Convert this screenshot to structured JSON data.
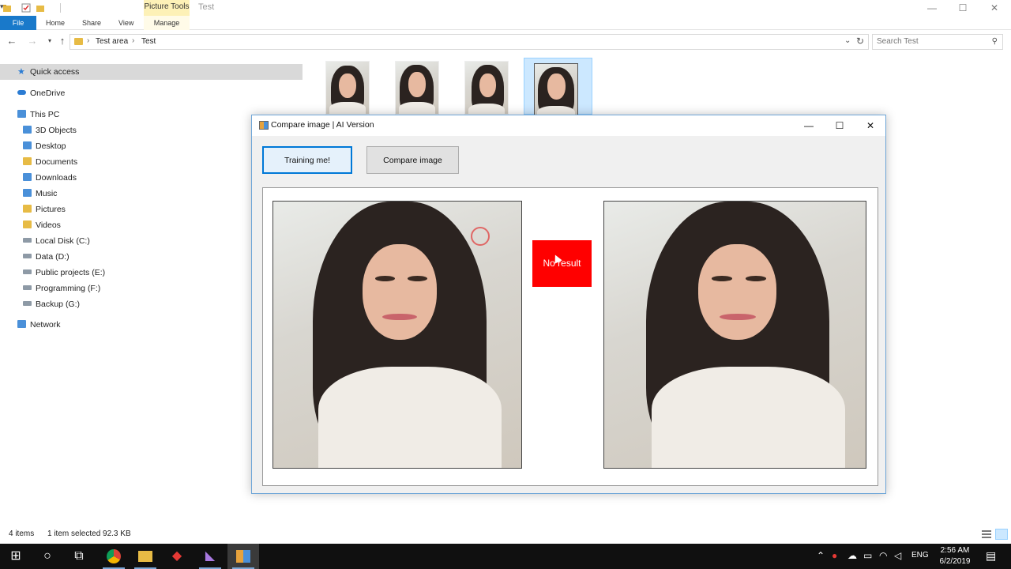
{
  "explorer": {
    "context_tab_group": "Picture Tools",
    "window_title": "Test",
    "caption": {
      "minimize": "—",
      "maximize": "☐",
      "close": "✕"
    },
    "ribbon_tabs": {
      "file": "File",
      "home": "Home",
      "share": "Share",
      "view": "View",
      "manage": "Manage"
    },
    "breadcrumb": [
      "Test area",
      "Test"
    ],
    "search_placeholder": "Search Test",
    "nav": {
      "quick_access": "Quick access",
      "onedrive": "OneDrive",
      "this_pc": "This PC",
      "items": [
        "3D Objects",
        "Desktop",
        "Documents",
        "Downloads",
        "Music",
        "Pictures",
        "Videos",
        "Local Disk (C:)",
        "Data (D:)",
        "Public projects (E:)",
        "Programming (F:)",
        "Backup (G:)"
      ],
      "network": "Network"
    },
    "status": {
      "count": "4 items",
      "selection": "1 item selected  92.3 KB"
    }
  },
  "dialog": {
    "title": "Compare image | AI Version",
    "caption": {
      "minimize": "—",
      "maximize": "☐",
      "close": "✕"
    },
    "train_button": "Training me!",
    "compare_button": "Compare image",
    "result_text": "No result",
    "result_color": "#ff0000"
  },
  "taskbar": {
    "language": "ENG",
    "time": "2:56 AM",
    "date": "6/2/2019"
  },
  "colors": {
    "accent": "#0078d7",
    "file_tab": "#1979ca",
    "selection": "#cce8ff",
    "context_tab": "#fdf1b7"
  }
}
